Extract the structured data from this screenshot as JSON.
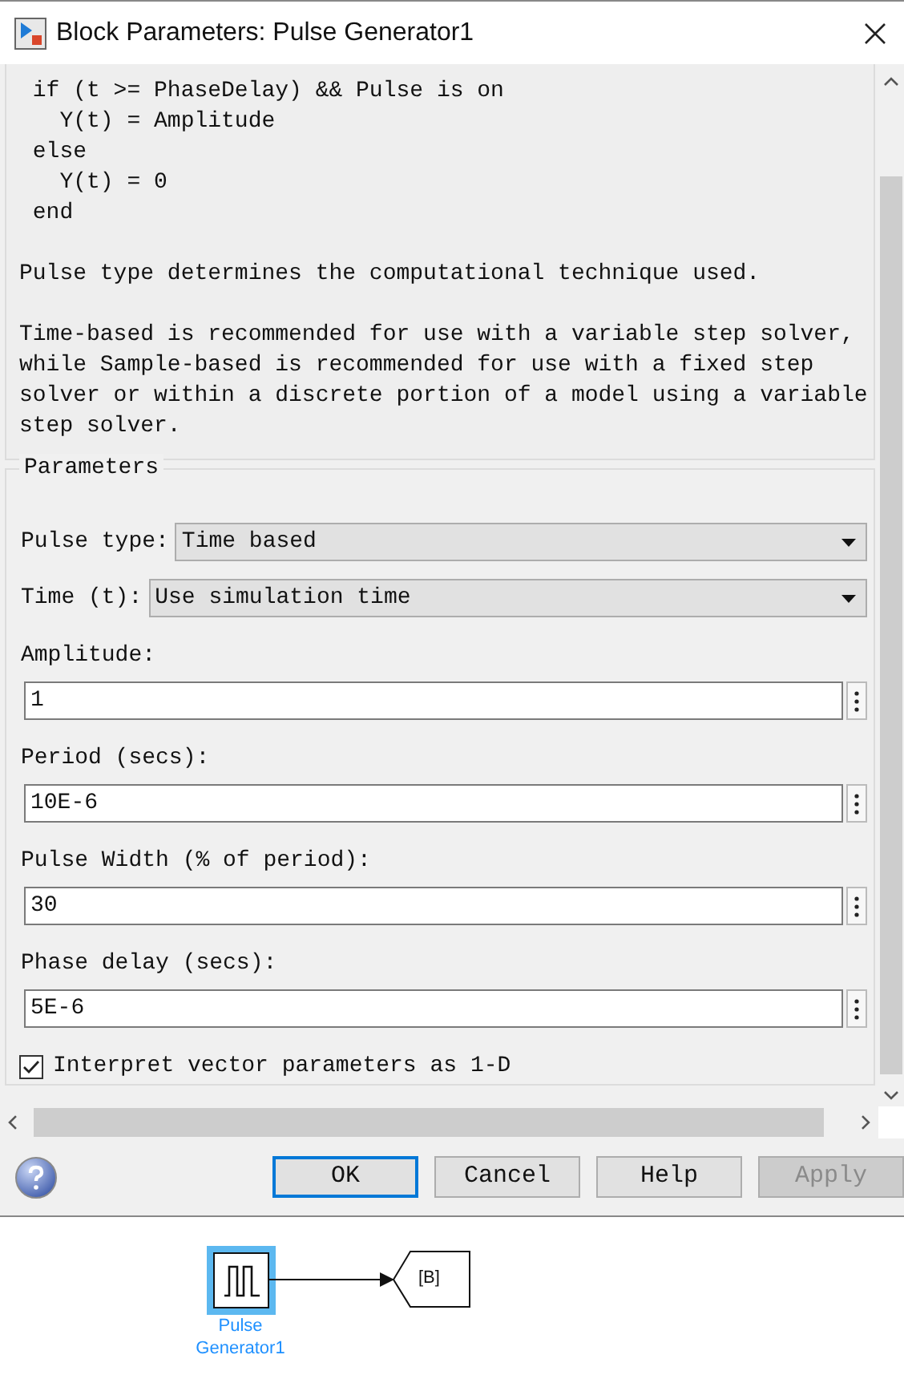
{
  "window": {
    "title": "Block Parameters: Pulse Generator1"
  },
  "description": {
    "code_lines": [
      " if (t >= PhaseDelay) && Pulse is on",
      "   Y(t) = Amplitude",
      " else",
      "   Y(t) = 0",
      " end"
    ],
    "paragraphs": [
      "Pulse type determines the computational technique used.",
      "Time-based is recommended for use with a variable step solver, while Sample-based is recommended for use with a fixed step solver or within a discrete portion of a model using a variable step solver."
    ]
  },
  "parameters": {
    "title": "Parameters",
    "dropdowns": [
      {
        "label": "Pulse type:",
        "value": "Time based"
      },
      {
        "label": "Time (t):",
        "value": "Use simulation time"
      }
    ],
    "fields": [
      {
        "label": "Amplitude:",
        "value": "1"
      },
      {
        "label": "Period (secs):",
        "value": "10E-6"
      },
      {
        "label": "Pulse Width (% of period):",
        "value": "30"
      },
      {
        "label": "Phase delay (secs):",
        "value": "5E-6"
      }
    ],
    "checkbox": {
      "label": "Interpret vector parameters as 1-D",
      "checked": true
    }
  },
  "buttons": [
    {
      "label": "OK",
      "focused": true,
      "disabled": false
    },
    {
      "label": "Cancel",
      "focused": false,
      "disabled": false
    },
    {
      "label": "Help",
      "focused": false,
      "disabled": false
    },
    {
      "label": "Apply",
      "focused": false,
      "disabled": true
    }
  ],
  "diagram": {
    "block_label": "Pulse Generator1",
    "block_selected": true,
    "goto_tag": "[B]"
  }
}
